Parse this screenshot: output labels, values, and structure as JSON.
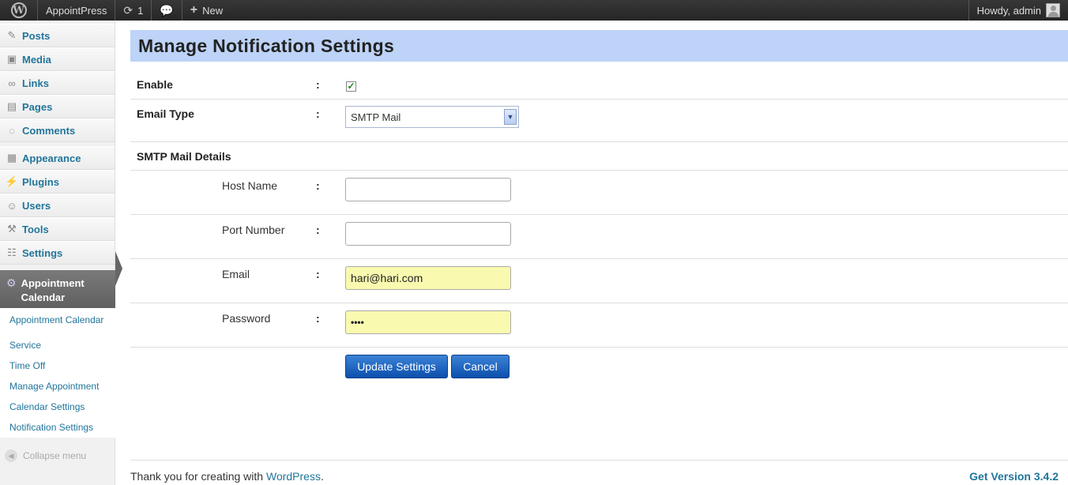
{
  "adminbar": {
    "logo_icon": "wordpress-logo-icon",
    "site_name": "AppointPress",
    "updates_count": "1",
    "new_label": "New",
    "greeting": "Howdy, admin"
  },
  "sidebar": {
    "items": [
      {
        "label": "Posts",
        "icon": "pin-icon"
      },
      {
        "label": "Media",
        "icon": "media-icon"
      },
      {
        "label": "Links",
        "icon": "link-icon"
      },
      {
        "label": "Pages",
        "icon": "pages-icon"
      },
      {
        "label": "Comments",
        "icon": "comment-icon"
      },
      {
        "label": "Appearance",
        "icon": "appearance-icon"
      },
      {
        "label": "Plugins",
        "icon": "plugin-icon"
      },
      {
        "label": "Users",
        "icon": "users-icon"
      },
      {
        "label": "Tools",
        "icon": "tools-icon"
      },
      {
        "label": "Settings",
        "icon": "settings-icon"
      }
    ],
    "current_line1": "Appointment",
    "current_line2": "Calendar",
    "submenu": [
      "Appointment Calendar",
      "Service",
      "Time Off",
      "Manage Appointment",
      "Calendar Settings",
      "Notification Settings"
    ],
    "collapse_label": "Collapse menu"
  },
  "main": {
    "title": "Manage Notification Settings",
    "colon": ":",
    "enable_label": "Enable",
    "enable_checked": true,
    "email_type_label": "Email Type",
    "email_type_value": "SMTP Mail",
    "smtp_section": "SMTP Mail Details",
    "host_label": "Host Name",
    "host_value": "",
    "port_label": "Port Number",
    "port_value": "",
    "email_label": "Email",
    "email_value": "hari@hari.com",
    "password_label": "Password",
    "password_value": "••••",
    "update_button": "Update Settings",
    "cancel_button": "Cancel"
  },
  "footer": {
    "thanks_prefix": "Thank you for creating with ",
    "wordpress_link": "WordPress",
    "thanks_suffix": ".",
    "version": "Get Version 3.4.2"
  },
  "colors": {
    "adminbar_bg": "#262626",
    "header_bg": "#bdd3f7",
    "link": "#21759b",
    "button": "#0c4fad",
    "autofill": "#f9f9b0"
  }
}
